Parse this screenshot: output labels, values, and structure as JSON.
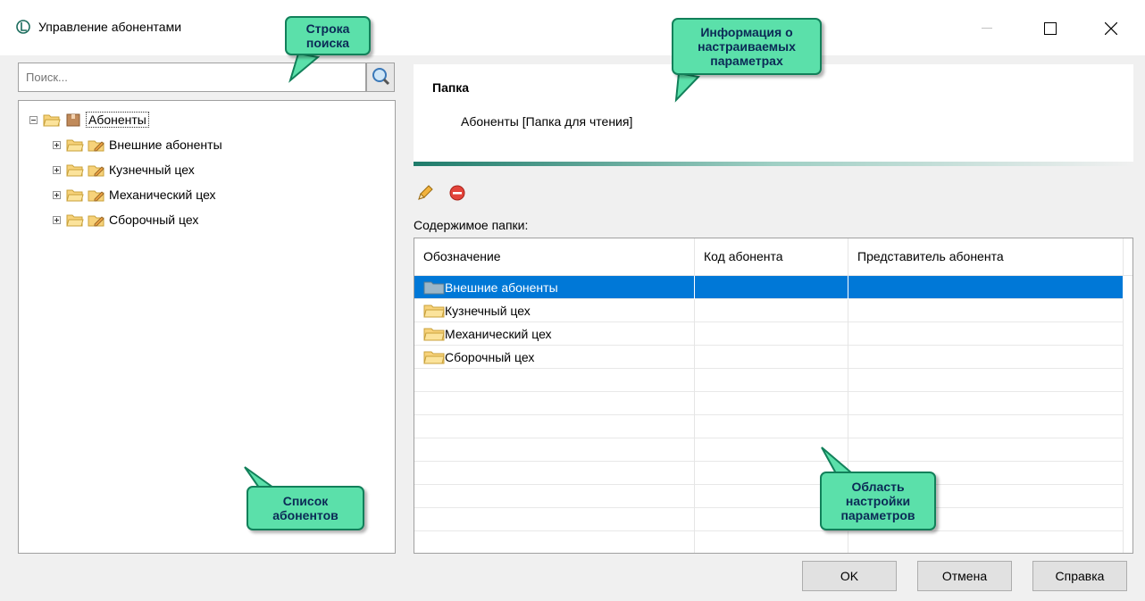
{
  "window": {
    "title": "Управление абонентами"
  },
  "search": {
    "placeholder": "Поиск..."
  },
  "tree": {
    "root": "Абоненты",
    "children": [
      "Внешние абоненты",
      "Кузнечный цех",
      "Механический цех",
      "Сборочный цех"
    ]
  },
  "info": {
    "title": "Папка",
    "text": "Абоненты [Папка для чтения]"
  },
  "content": {
    "label": "Содержимое папки:",
    "columns": [
      "Обозначение",
      "Код абонента",
      "Представитель абонента"
    ],
    "rows": [
      {
        "name": "Внешние абоненты",
        "code": "",
        "rep": ""
      },
      {
        "name": "Кузнечный цех",
        "code": "",
        "rep": ""
      },
      {
        "name": "Механический цех",
        "code": "",
        "rep": ""
      },
      {
        "name": "Сборочный цех",
        "code": "",
        "rep": ""
      }
    ]
  },
  "buttons": {
    "ok": "OK",
    "cancel": "Отмена",
    "help": "Справка"
  },
  "callouts": {
    "search": [
      "Строка",
      "поиска"
    ],
    "info": [
      "Информация о",
      "настраиваемых",
      "параметрах"
    ],
    "list": [
      "Список",
      "абонентов"
    ],
    "params": [
      "Область",
      "настройки",
      "параметров"
    ]
  },
  "colors": {
    "selection": "#0078d7",
    "callout_fill": "#5be0aa",
    "callout_border": "#12805a",
    "accent_line": "#1e7b6a"
  }
}
